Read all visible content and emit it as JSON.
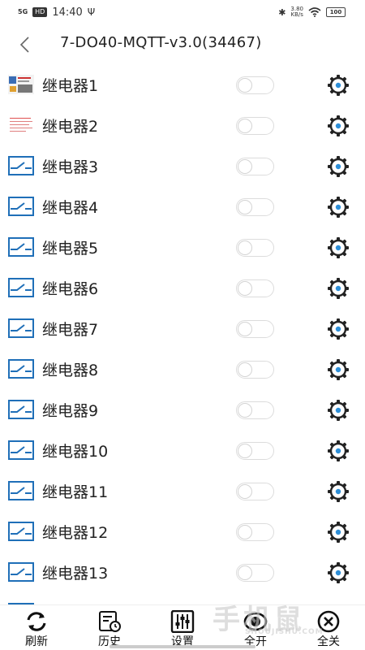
{
  "status_bar": {
    "signal": "5G",
    "hd": "HD",
    "time": "14:40",
    "usb": "Ψ",
    "bluetooth": "✱",
    "speed_value": "3.80",
    "speed_unit": "KB/s",
    "battery": "100"
  },
  "header": {
    "back_glyph": "〈",
    "title": "7-DO40-MQTT-v3.0(34467)"
  },
  "relays": [
    {
      "label": "继电器1",
      "icon": "photo-thumbnail-icon",
      "on": false
    },
    {
      "label": "继电器2",
      "icon": "document-thumbnail-icon",
      "on": false
    },
    {
      "label": "继电器3",
      "icon": "relay-switch-icon",
      "on": false
    },
    {
      "label": "继电器4",
      "icon": "relay-switch-icon",
      "on": false
    },
    {
      "label": "继电器5",
      "icon": "relay-switch-icon",
      "on": false
    },
    {
      "label": "继电器6",
      "icon": "relay-switch-icon",
      "on": false
    },
    {
      "label": "继电器7",
      "icon": "relay-switch-icon",
      "on": false
    },
    {
      "label": "继电器8",
      "icon": "relay-switch-icon",
      "on": false
    },
    {
      "label": "继电器9",
      "icon": "relay-switch-icon",
      "on": false
    },
    {
      "label": "继电器10",
      "icon": "relay-switch-icon",
      "on": false
    },
    {
      "label": "继电器11",
      "icon": "relay-switch-icon",
      "on": false
    },
    {
      "label": "继电器12",
      "icon": "relay-switch-icon",
      "on": false
    },
    {
      "label": "继电器13",
      "icon": "relay-switch-icon",
      "on": false
    }
  ],
  "nav": {
    "refresh": "刷新",
    "history": "历史",
    "settings": "设置",
    "all_on": "全开",
    "all_off": "全关"
  },
  "watermark": {
    "main": "手机鼠",
    "sub": "SHOUJISHU.COM"
  },
  "colors": {
    "relay_icon": "#1f6fb8",
    "gear_dot": "#2e8fd8",
    "toggle_border": "#dcdcdc"
  }
}
